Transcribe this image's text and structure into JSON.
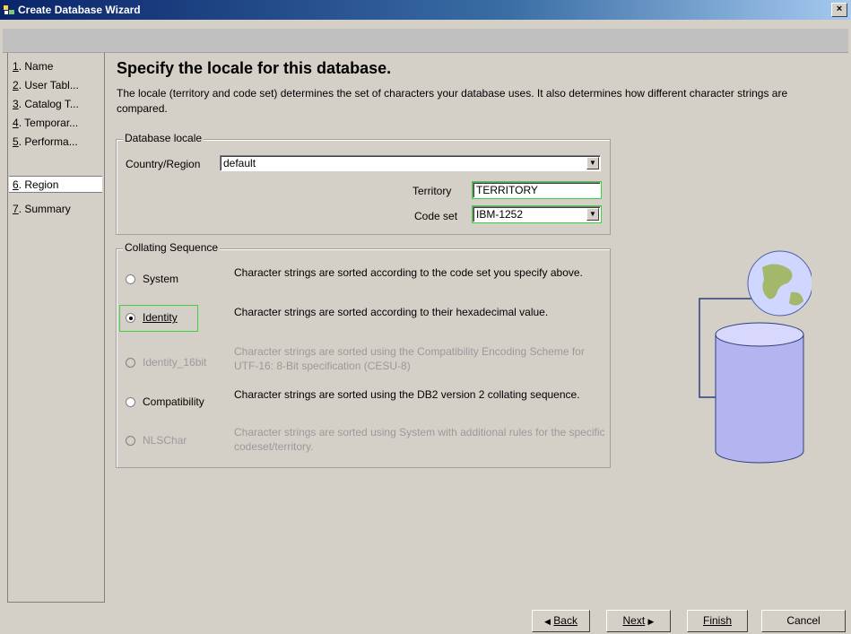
{
  "window": {
    "title": "Create Database Wizard",
    "close_symbol": "×"
  },
  "nav": {
    "items": [
      {
        "num": "1",
        "label": ". Name"
      },
      {
        "num": "2",
        "label": ". User Tabl..."
      },
      {
        "num": "3",
        "label": ". Catalog T..."
      },
      {
        "num": "4",
        "label": ". Temporar..."
      },
      {
        "num": "5",
        "label": ". Performa..."
      },
      {
        "num": "6",
        "label": ". Region"
      },
      {
        "num": "7",
        "label": ". Summary"
      }
    ],
    "selected_index": 5
  },
  "page": {
    "heading": "Specify the locale for this database.",
    "description": "The locale (territory and code set) determines the set of characters your database uses. It also determines how different character strings are compared."
  },
  "locale": {
    "group_title": "Database locale",
    "country_label": "Country/Region",
    "country_value": "default",
    "territory_label": "Territory",
    "territory_value": "TERRITORY",
    "codeset_label": "Code set",
    "codeset_value": "IBM-1252"
  },
  "collating": {
    "group_title": "Collating Sequence",
    "options": [
      {
        "label": "System",
        "mnemonic": "y",
        "description": "Character strings are sorted according to the code set you specify above.",
        "enabled": true,
        "checked": false
      },
      {
        "label": "Identity",
        "mnemonic": "I",
        "description": "Character strings are sorted according to their hexadecimal value.",
        "enabled": true,
        "checked": true
      },
      {
        "label": "Identity_16bit",
        "mnemonic": "d",
        "description": "Character strings are sorted using the Compatibility Encoding Scheme for UTF-16: 8-Bit specification (CESU-8)",
        "enabled": false,
        "checked": false
      },
      {
        "label": "Compatibility",
        "mnemonic": "C",
        "description": "Character strings are sorted using the DB2 version 2 collating sequence.",
        "enabled": true,
        "checked": false
      },
      {
        "label": "NLSChar",
        "mnemonic": "L",
        "description": "Character strings are sorted using System with additional rules for the specific codeset/territory.",
        "enabled": false,
        "checked": false
      }
    ]
  },
  "buttons": {
    "back": "Back",
    "next": "Next",
    "finish": "Finish",
    "cancel": "Cancel",
    "back_arrow": "◀",
    "next_arrow": "▶"
  },
  "icons": {
    "dropdown": "▼",
    "graphic": "database-globe-icon"
  },
  "colors": {
    "title_start": "#0a246a",
    "highlight": "#3fd13f",
    "cylinder": "#b4b4f0",
    "globe": "#cfd6ff"
  }
}
